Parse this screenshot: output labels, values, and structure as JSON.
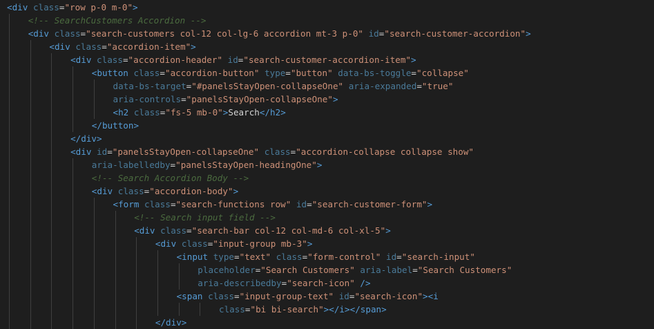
{
  "colors": {
    "background": "#1e1e1e",
    "tag": "#569cd6",
    "punctuation": "#808080",
    "text": "#d4d4d4",
    "attribute": "#9cdcfe",
    "attribute_dimmed": "#4a7a99",
    "string": "#ce9178",
    "comment": "#6a9955",
    "indent_guide": "#404040"
  },
  "lines": [
    {
      "indent": 0,
      "tokens": [
        {
          "t": "tag",
          "v": "<div"
        },
        {
          "t": "text",
          "v": " "
        },
        {
          "t": "dimattr",
          "v": "class"
        },
        {
          "t": "text",
          "v": "="
        },
        {
          "t": "val",
          "v": "\"row p-0 m-0\""
        },
        {
          "t": "tag",
          "v": ">"
        }
      ]
    },
    {
      "indent": 1,
      "tokens": [
        {
          "t": "dimcomment",
          "v": "<!-- SearchCustomers Accordion -->"
        }
      ]
    },
    {
      "indent": 1,
      "tokens": [
        {
          "t": "tag",
          "v": "<div"
        },
        {
          "t": "text",
          "v": " "
        },
        {
          "t": "dimattr",
          "v": "class"
        },
        {
          "t": "text",
          "v": "="
        },
        {
          "t": "val",
          "v": "\"search-customers col-12 col-lg-6 accordion mt-3 p-0\""
        },
        {
          "t": "text",
          "v": " "
        },
        {
          "t": "dimattr",
          "v": "id"
        },
        {
          "t": "text",
          "v": "="
        },
        {
          "t": "val",
          "v": "\"search-customer-accordion\""
        },
        {
          "t": "tag",
          "v": ">"
        }
      ]
    },
    {
      "indent": 2,
      "tokens": [
        {
          "t": "tag",
          "v": "<div"
        },
        {
          "t": "text",
          "v": " "
        },
        {
          "t": "dimattr",
          "v": "class"
        },
        {
          "t": "text",
          "v": "="
        },
        {
          "t": "val",
          "v": "\"accordion-item\""
        },
        {
          "t": "tag",
          "v": ">"
        }
      ]
    },
    {
      "indent": 3,
      "tokens": [
        {
          "t": "tag",
          "v": "<div"
        },
        {
          "t": "text",
          "v": " "
        },
        {
          "t": "dimattr",
          "v": "class"
        },
        {
          "t": "text",
          "v": "="
        },
        {
          "t": "val",
          "v": "\"accordion-header\""
        },
        {
          "t": "text",
          "v": " "
        },
        {
          "t": "dimattr",
          "v": "id"
        },
        {
          "t": "text",
          "v": "="
        },
        {
          "t": "val",
          "v": "\"search-customer-accordion-item\""
        },
        {
          "t": "tag",
          "v": ">"
        }
      ]
    },
    {
      "indent": 4,
      "tokens": [
        {
          "t": "tag",
          "v": "<button"
        },
        {
          "t": "text",
          "v": " "
        },
        {
          "t": "dimattr",
          "v": "class"
        },
        {
          "t": "text",
          "v": "="
        },
        {
          "t": "val",
          "v": "\"accordion-button\""
        },
        {
          "t": "text",
          "v": " "
        },
        {
          "t": "dimattr",
          "v": "type"
        },
        {
          "t": "text",
          "v": "="
        },
        {
          "t": "val",
          "v": "\"button\""
        },
        {
          "t": "text",
          "v": " "
        },
        {
          "t": "dimattr",
          "v": "data-bs-toggle"
        },
        {
          "t": "text",
          "v": "="
        },
        {
          "t": "val",
          "v": "\"collapse\""
        }
      ]
    },
    {
      "indent": 5,
      "tokens": [
        {
          "t": "dimattr",
          "v": "data-bs-target"
        },
        {
          "t": "text",
          "v": "="
        },
        {
          "t": "val",
          "v": "\"#panelsStayOpen-collapseOne\""
        },
        {
          "t": "text",
          "v": " "
        },
        {
          "t": "dimattr",
          "v": "aria-expanded"
        },
        {
          "t": "text",
          "v": "="
        },
        {
          "t": "val",
          "v": "\"true\""
        }
      ]
    },
    {
      "indent": 5,
      "tokens": [
        {
          "t": "dimattr",
          "v": "aria-controls"
        },
        {
          "t": "text",
          "v": "="
        },
        {
          "t": "val",
          "v": "\"panelsStayOpen-collapseOne\""
        },
        {
          "t": "tag",
          "v": ">"
        }
      ]
    },
    {
      "indent": 5,
      "tokens": [
        {
          "t": "tag",
          "v": "<h2"
        },
        {
          "t": "text",
          "v": " "
        },
        {
          "t": "dimattr",
          "v": "class"
        },
        {
          "t": "text",
          "v": "="
        },
        {
          "t": "val",
          "v": "\"fs-5 mb-0\""
        },
        {
          "t": "tag",
          "v": ">"
        },
        {
          "t": "text",
          "v": "Search"
        },
        {
          "t": "tag",
          "v": "</h2>"
        }
      ]
    },
    {
      "indent": 4,
      "tokens": [
        {
          "t": "tag",
          "v": "</button>"
        }
      ]
    },
    {
      "indent": 3,
      "tokens": [
        {
          "t": "tag",
          "v": "</div>"
        }
      ]
    },
    {
      "indent": 3,
      "tokens": [
        {
          "t": "tag",
          "v": "<div"
        },
        {
          "t": "text",
          "v": " "
        },
        {
          "t": "dimattr",
          "v": "id"
        },
        {
          "t": "text",
          "v": "="
        },
        {
          "t": "val",
          "v": "\"panelsStayOpen-collapseOne\""
        },
        {
          "t": "text",
          "v": " "
        },
        {
          "t": "dimattr",
          "v": "class"
        },
        {
          "t": "text",
          "v": "="
        },
        {
          "t": "val",
          "v": "\"accordion-collapse collapse show\""
        }
      ]
    },
    {
      "indent": 4,
      "tokens": [
        {
          "t": "dimattr",
          "v": "aria-labelledby"
        },
        {
          "t": "text",
          "v": "="
        },
        {
          "t": "val",
          "v": "\"panelsStayOpen-headingOne\""
        },
        {
          "t": "tag",
          "v": ">"
        }
      ]
    },
    {
      "indent": 4,
      "tokens": [
        {
          "t": "dimcomment",
          "v": "<!-- Search Accordion Body -->"
        }
      ]
    },
    {
      "indent": 4,
      "tokens": [
        {
          "t": "tag",
          "v": "<div"
        },
        {
          "t": "text",
          "v": " "
        },
        {
          "t": "dimattr",
          "v": "class"
        },
        {
          "t": "text",
          "v": "="
        },
        {
          "t": "val",
          "v": "\"accordion-body\""
        },
        {
          "t": "tag",
          "v": ">"
        }
      ]
    },
    {
      "indent": 5,
      "tokens": [
        {
          "t": "tag",
          "v": "<form"
        },
        {
          "t": "text",
          "v": " "
        },
        {
          "t": "dimattr",
          "v": "class"
        },
        {
          "t": "text",
          "v": "="
        },
        {
          "t": "val",
          "v": "\"search-functions row\""
        },
        {
          "t": "text",
          "v": " "
        },
        {
          "t": "dimattr",
          "v": "id"
        },
        {
          "t": "text",
          "v": "="
        },
        {
          "t": "val",
          "v": "\"search-customer-form\""
        },
        {
          "t": "tag",
          "v": ">"
        }
      ]
    },
    {
      "indent": 6,
      "tokens": [
        {
          "t": "dimcomment",
          "v": "<!-- Search input field -->"
        }
      ]
    },
    {
      "indent": 6,
      "tokens": [
        {
          "t": "tag",
          "v": "<div"
        },
        {
          "t": "text",
          "v": " "
        },
        {
          "t": "dimattr",
          "v": "class"
        },
        {
          "t": "text",
          "v": "="
        },
        {
          "t": "val",
          "v": "\"search-bar col-12 col-md-6 col-xl-5\""
        },
        {
          "t": "tag",
          "v": ">"
        }
      ]
    },
    {
      "indent": 7,
      "tokens": [
        {
          "t": "tag",
          "v": "<div"
        },
        {
          "t": "text",
          "v": " "
        },
        {
          "t": "dimattr",
          "v": "class"
        },
        {
          "t": "text",
          "v": "="
        },
        {
          "t": "val",
          "v": "\"input-group mb-3\""
        },
        {
          "t": "tag",
          "v": ">"
        }
      ]
    },
    {
      "indent": 8,
      "tokens": [
        {
          "t": "tag",
          "v": "<input"
        },
        {
          "t": "text",
          "v": " "
        },
        {
          "t": "dimattr",
          "v": "type"
        },
        {
          "t": "text",
          "v": "="
        },
        {
          "t": "val",
          "v": "\"text\""
        },
        {
          "t": "text",
          "v": " "
        },
        {
          "t": "dimattr",
          "v": "class"
        },
        {
          "t": "text",
          "v": "="
        },
        {
          "t": "val",
          "v": "\"form-control\""
        },
        {
          "t": "text",
          "v": " "
        },
        {
          "t": "dimattr",
          "v": "id"
        },
        {
          "t": "text",
          "v": "="
        },
        {
          "t": "val",
          "v": "\"search-input\""
        }
      ]
    },
    {
      "indent": 9,
      "tokens": [
        {
          "t": "dimattr",
          "v": "placeholder"
        },
        {
          "t": "text",
          "v": "="
        },
        {
          "t": "val",
          "v": "\"Search Customers\""
        },
        {
          "t": "text",
          "v": " "
        },
        {
          "t": "dimattr",
          "v": "aria-label"
        },
        {
          "t": "text",
          "v": "="
        },
        {
          "t": "val",
          "v": "\"Search Customers\""
        }
      ]
    },
    {
      "indent": 9,
      "tokens": [
        {
          "t": "dimattr",
          "v": "aria-describedby"
        },
        {
          "t": "text",
          "v": "="
        },
        {
          "t": "val",
          "v": "\"search-icon\""
        },
        {
          "t": "text",
          "v": " "
        },
        {
          "t": "tag",
          "v": "/>"
        }
      ]
    },
    {
      "indent": 8,
      "tokens": [
        {
          "t": "tag",
          "v": "<span"
        },
        {
          "t": "text",
          "v": " "
        },
        {
          "t": "dimattr",
          "v": "class"
        },
        {
          "t": "text",
          "v": "="
        },
        {
          "t": "val",
          "v": "\"input-group-text\""
        },
        {
          "t": "text",
          "v": " "
        },
        {
          "t": "dimattr",
          "v": "id"
        },
        {
          "t": "text",
          "v": "="
        },
        {
          "t": "val",
          "v": "\"search-icon\""
        },
        {
          "t": "tag",
          "v": ">"
        },
        {
          "t": "tag",
          "v": "<i"
        }
      ]
    },
    {
      "indent": 10,
      "tokens": [
        {
          "t": "dimattr",
          "v": "class"
        },
        {
          "t": "text",
          "v": "="
        },
        {
          "t": "val",
          "v": "\"bi bi-search\""
        },
        {
          "t": "tag",
          "v": ">"
        },
        {
          "t": "tag",
          "v": "</i>"
        },
        {
          "t": "tag",
          "v": "</span>"
        }
      ]
    },
    {
      "indent": 7,
      "tokens": [
        {
          "t": "tag",
          "v": "</div>"
        }
      ]
    }
  ]
}
